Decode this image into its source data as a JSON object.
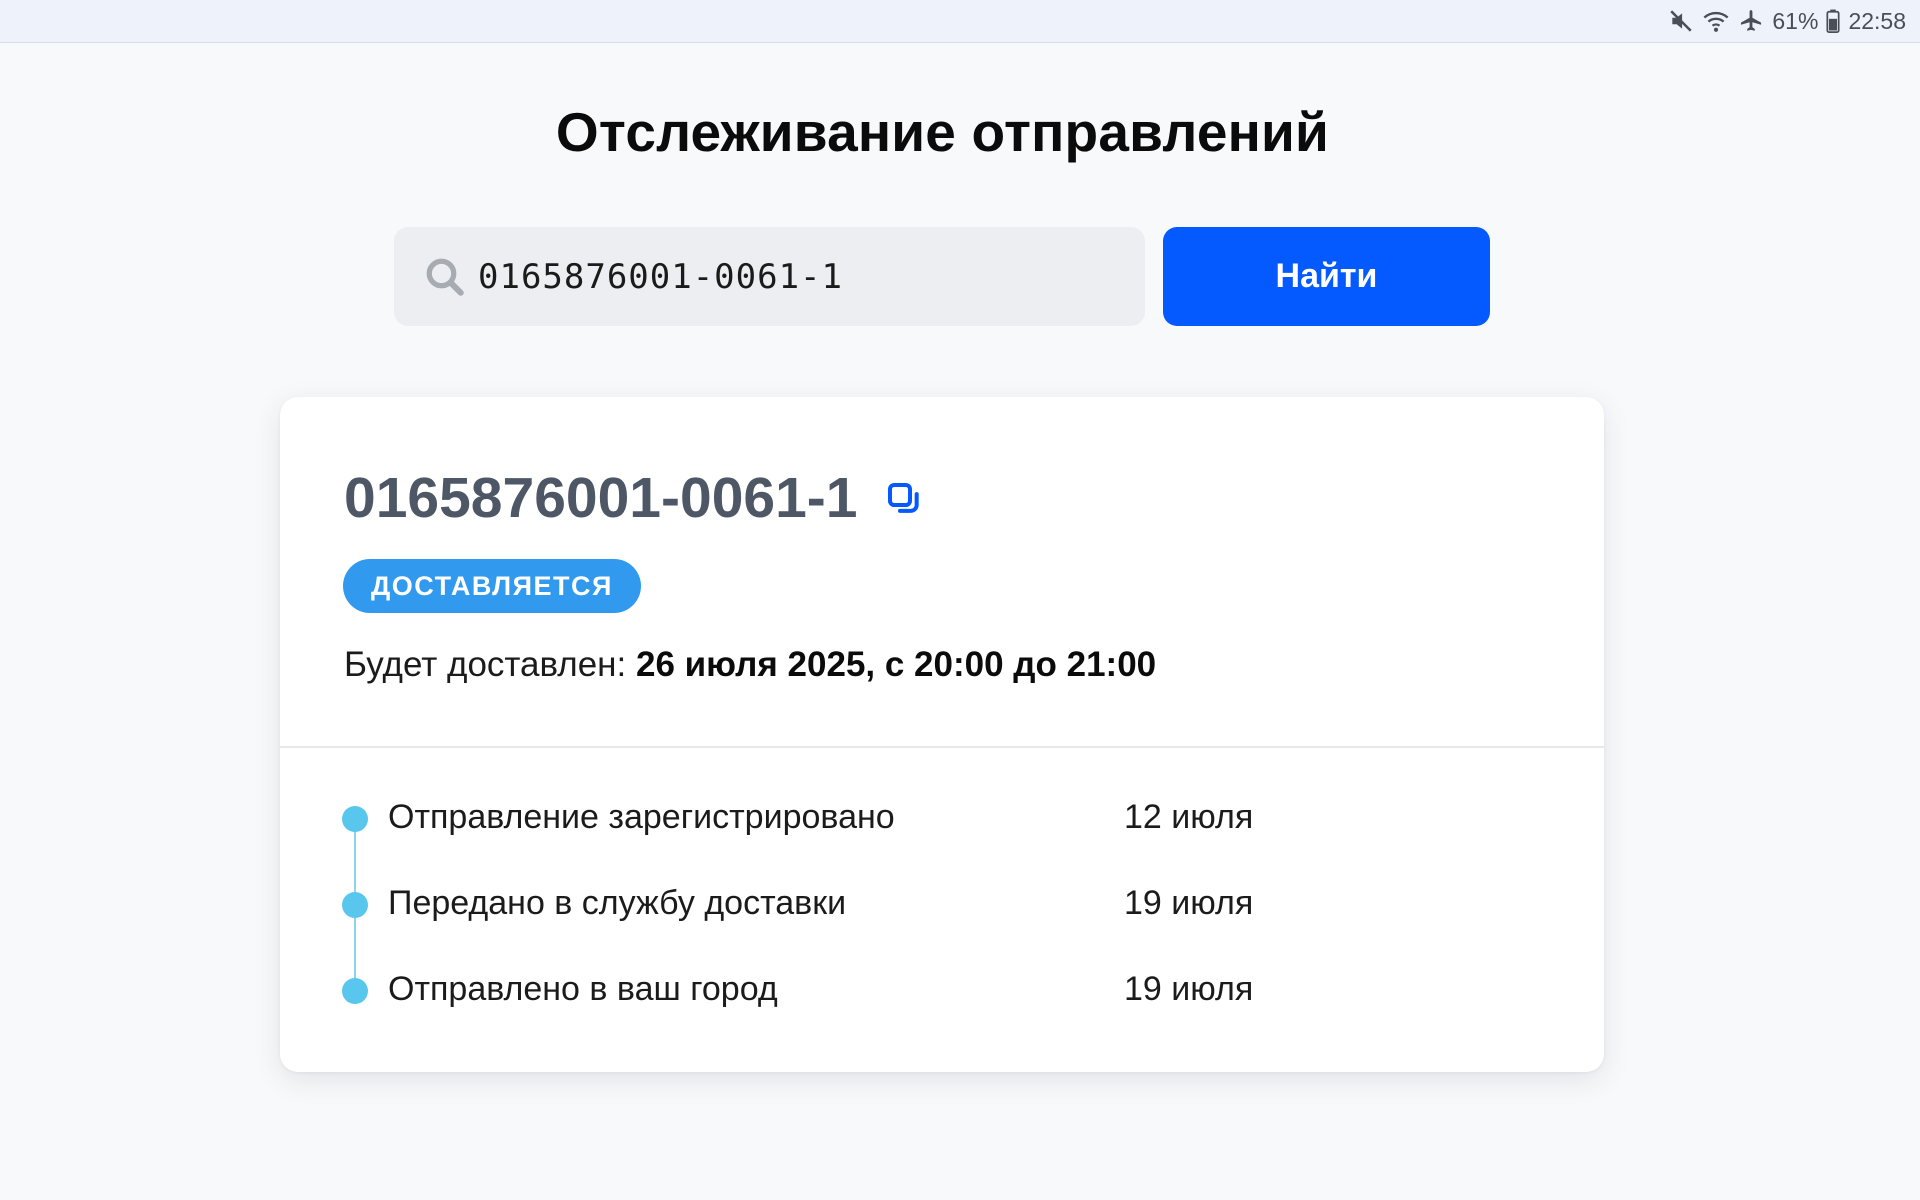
{
  "status_bar": {
    "battery": "61%",
    "time": "22:58",
    "icons": [
      "mute-icon",
      "wifi-icon",
      "airplane-icon",
      "battery-icon"
    ]
  },
  "page": {
    "title": "Отслеживание отправлений"
  },
  "search": {
    "value": "0165876001-0061-1",
    "button_label": "Найти"
  },
  "shipment": {
    "tracking_number": "0165876001-0061-1",
    "status": "ДОСТАВЛЯЕТСЯ",
    "delivery_prefix": "Будет доставлен:",
    "delivery_value": "26 июля 2025, с 20:00 до 21:00",
    "events": [
      {
        "label": "Отправление зарегистрировано",
        "date": "12 июля"
      },
      {
        "label": "Передано в службу доставки",
        "date": "19 июля"
      },
      {
        "label": "Отправлено в ваш город",
        "date": "19 июля"
      }
    ]
  },
  "colors": {
    "accent": "#0459ff",
    "badge": "#3199ee",
    "timeline_dot": "#59c6ee"
  }
}
